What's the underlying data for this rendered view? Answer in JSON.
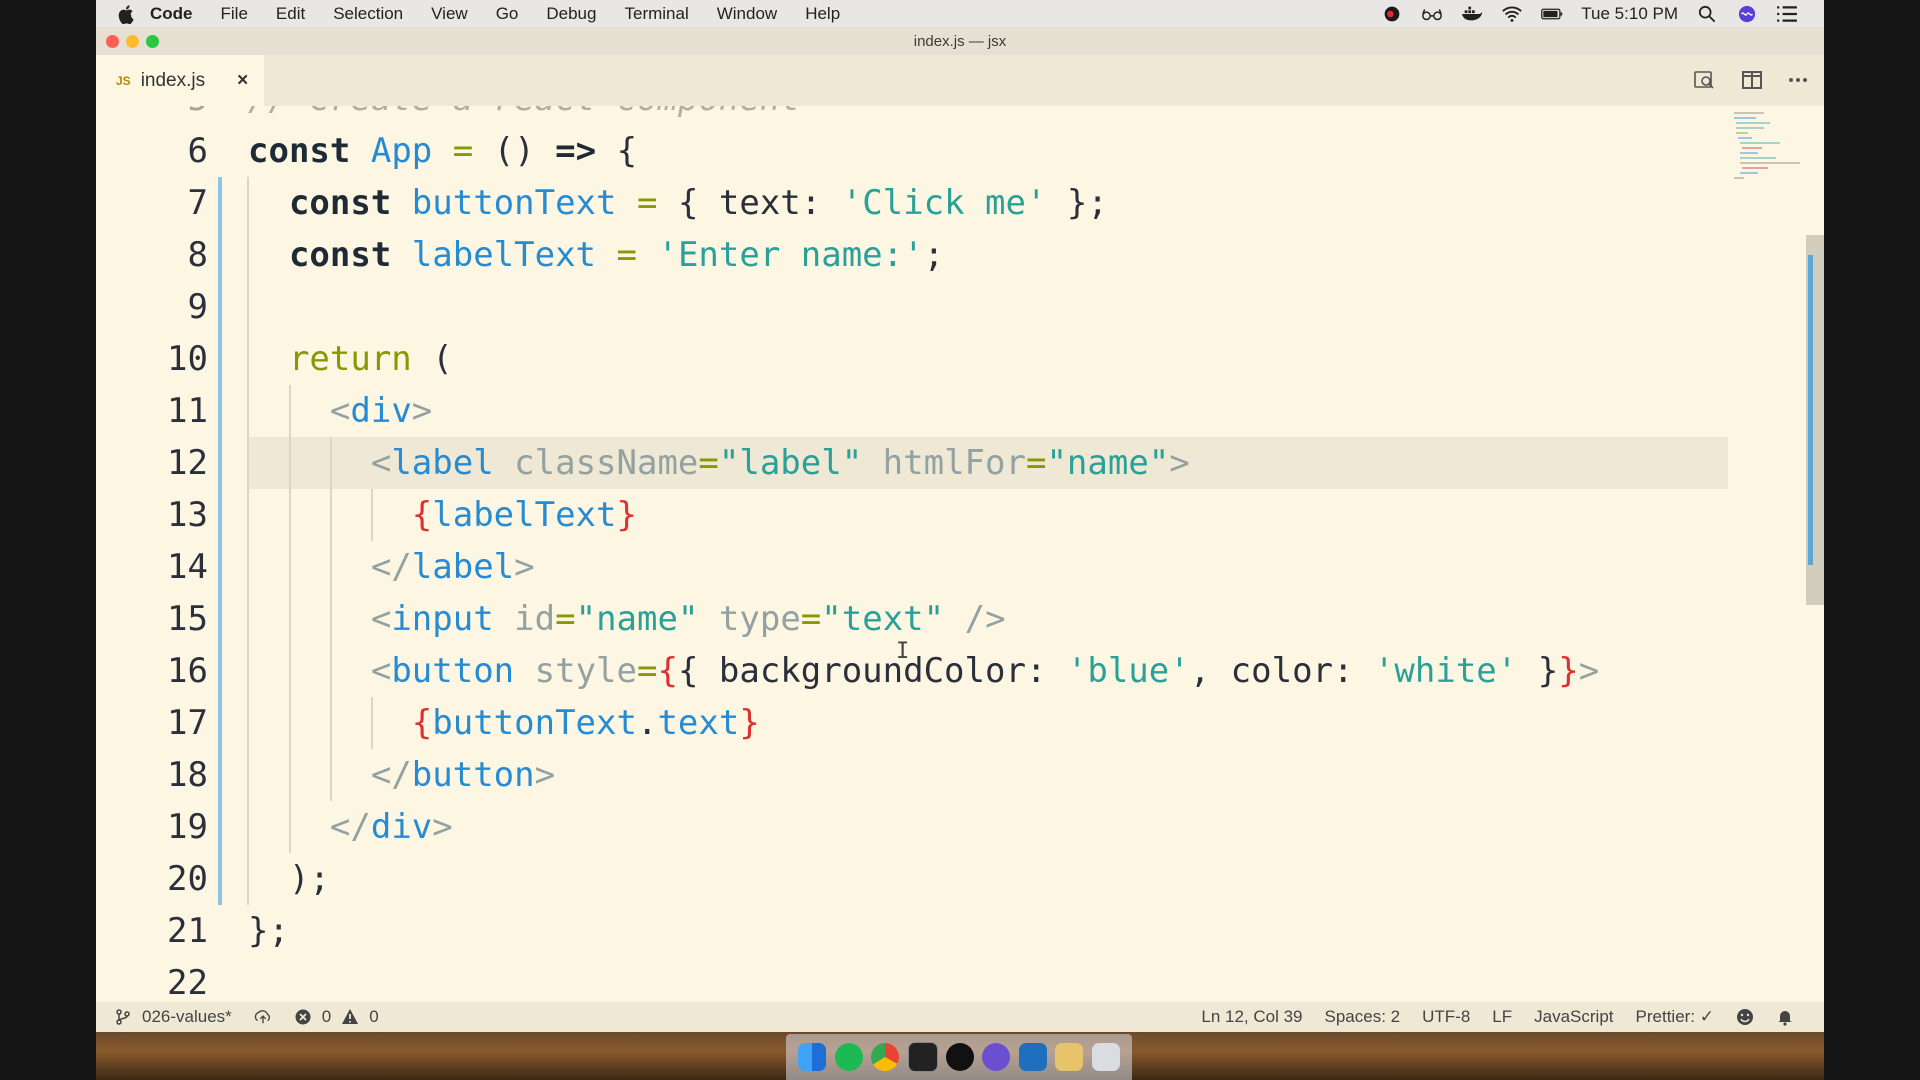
{
  "menubar": {
    "items": [
      "Code",
      "File",
      "Edit",
      "Selection",
      "View",
      "Go",
      "Debug",
      "Terminal",
      "Window",
      "Help"
    ],
    "clock": "Tue 5:10 PM"
  },
  "window": {
    "title": "index.js — jsx"
  },
  "tab": {
    "icon_label": "JS",
    "filename": "index.js",
    "close_glyph": "×"
  },
  "editor": {
    "ghost_line": "// Create a react component",
    "line_numbers": [
      "6",
      "7",
      "8",
      "9",
      "10",
      "11",
      "12",
      "13",
      "14",
      "15",
      "16",
      "17",
      "18",
      "19",
      "20",
      "21",
      "22"
    ],
    "current_line": "12"
  },
  "statusbar": {
    "branch": "026-values*",
    "errors": "0",
    "warnings": "0",
    "position": "Ln 12, Col 39",
    "spaces": "Spaces: 2",
    "encoding": "UTF-8",
    "eol": "LF",
    "language": "JavaScript",
    "formatter": "Prettier: ✓"
  },
  "colors": {
    "editor_bg": "#fdf6e3",
    "keyword": "#1e2b36",
    "identifier": "#268bd2",
    "operator": "#859900",
    "string": "#2aa198",
    "brace": "#dc322f",
    "attribute": "#93a1a1"
  },
  "icons": [
    "apple-icon",
    "creative-cloud-icon",
    "glasses-icon",
    "docker-icon",
    "wifi-icon",
    "battery-icon",
    "spotlight-icon",
    "siri-icon",
    "notification-center-icon",
    "search-references-icon",
    "split-editor-icon",
    "more-actions-icon",
    "branch-icon",
    "sync-icon",
    "error-icon",
    "warning-icon",
    "feedback-smiley-icon",
    "bell-icon"
  ],
  "dock": [
    "finder",
    "spotify",
    "chrome",
    "terminal",
    "obs",
    "vs-code-insiders",
    "vs-code",
    "folder",
    "trash"
  ]
}
